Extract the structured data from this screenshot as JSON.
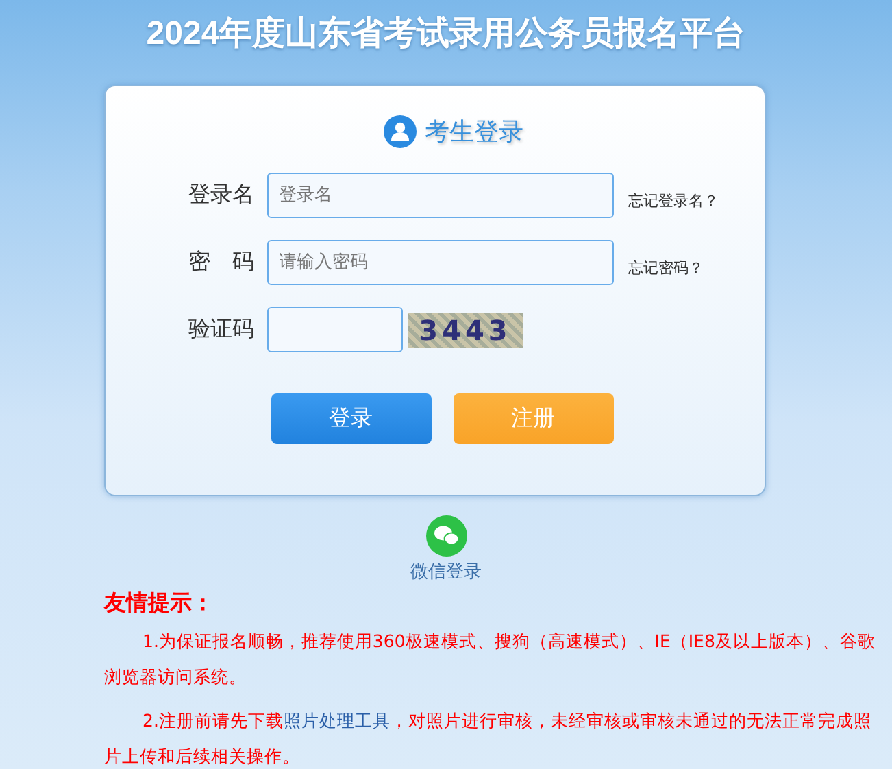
{
  "page_title": "2024年度山东省考试录用公务员报名平台",
  "login": {
    "heading": "考生登录",
    "fields": [
      {
        "label": "登录名",
        "placeholder": "登录名",
        "link": "忘记登录名？",
        "kind": "wide"
      },
      {
        "label": "密　码",
        "placeholder": "请输入密码",
        "link": "忘记密码？",
        "kind": "wide"
      },
      {
        "label": "验证码",
        "kind": "captcha",
        "captcha": "3443"
      }
    ],
    "buttons": [
      {
        "label": "登录",
        "kind": "primary"
      },
      {
        "label": "注册",
        "kind": "secondary"
      }
    ]
  },
  "wechat_login": "微信登录",
  "tips": {
    "title": "友情提示：",
    "items": [
      {
        "before": "1.为保证报名顺畅，推荐使用360极速模式、搜狗（高速模式）、IE（IE8及以上版本）、谷歌浏览器访问系统。"
      },
      {
        "before": "2.注册前请先下载",
        "link": "照片处理工具",
        "after": "，对照片进行审核，未经审核或审核未通过的无法正常完成照片上传和后续相关操作。"
      }
    ]
  }
}
